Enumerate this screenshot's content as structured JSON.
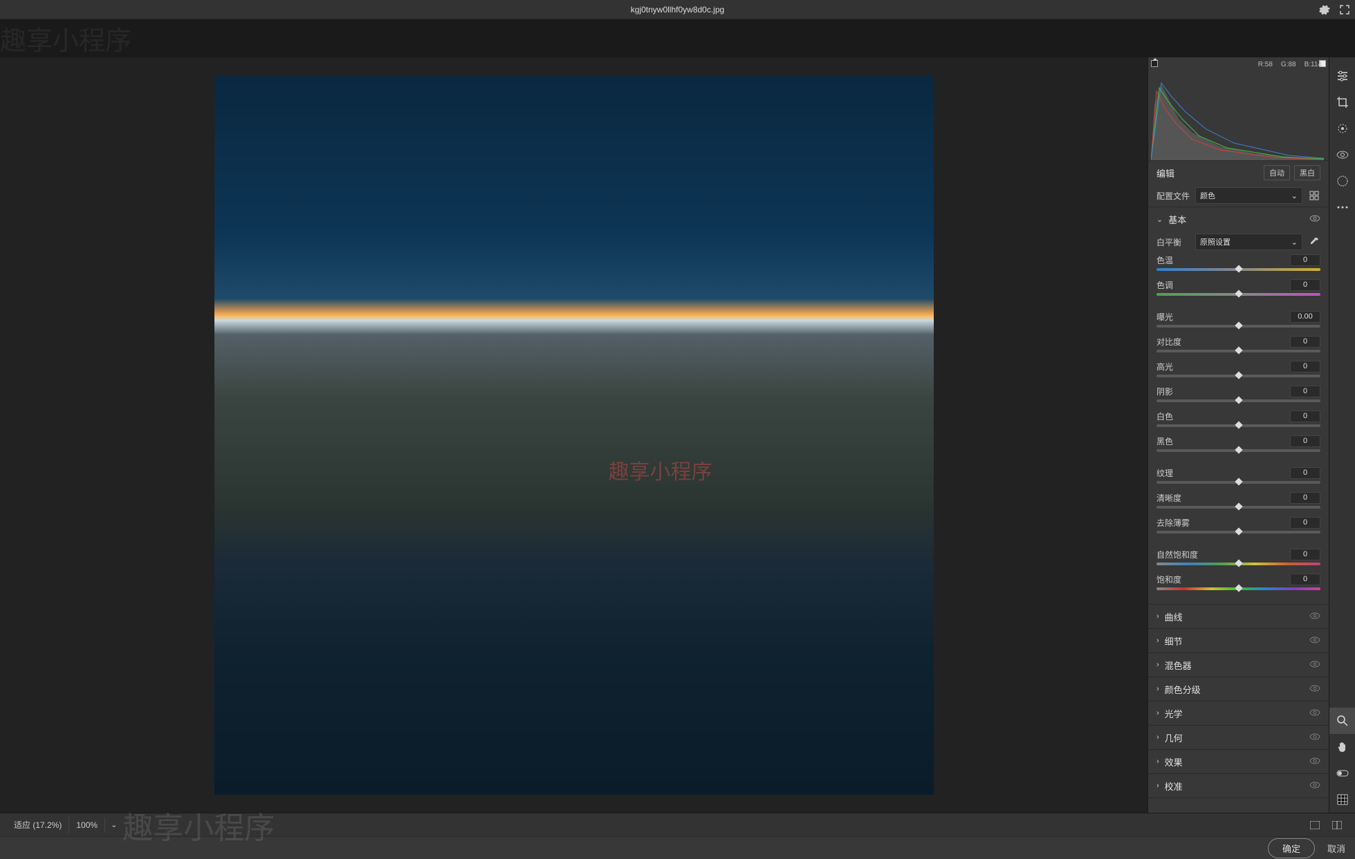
{
  "title": "kgj0tnyw0llhf0yw8d0c.jpg",
  "histogram": {
    "r": "R:58",
    "g": "G:88",
    "b": "B:114"
  },
  "edit": {
    "label": "编辑",
    "auto": "自动",
    "bw": "黑白"
  },
  "profile": {
    "label": "配置文件",
    "value": "颜色"
  },
  "basic": {
    "label": "基本",
    "wb_label": "白平衡",
    "wb_value": "原照设置",
    "sliders1": [
      {
        "label": "色温",
        "value": "0",
        "track": "temp",
        "pos": 50
      },
      {
        "label": "色调",
        "value": "0",
        "track": "tint",
        "pos": 50
      }
    ],
    "sliders2": [
      {
        "label": "曝光",
        "value": "0.00",
        "track": "gray",
        "pos": 50
      },
      {
        "label": "对比度",
        "value": "0",
        "track": "gray",
        "pos": 50
      },
      {
        "label": "高光",
        "value": "0",
        "track": "gray",
        "pos": 50
      },
      {
        "label": "阴影",
        "value": "0",
        "track": "gray",
        "pos": 50
      },
      {
        "label": "白色",
        "value": "0",
        "track": "gray",
        "pos": 50
      },
      {
        "label": "黑色",
        "value": "0",
        "track": "gray",
        "pos": 50
      }
    ],
    "sliders3": [
      {
        "label": "纹理",
        "value": "0",
        "track": "gray",
        "pos": 50
      },
      {
        "label": "清晰度",
        "value": "0",
        "track": "gray",
        "pos": 50
      },
      {
        "label": "去除薄雾",
        "value": "0",
        "track": "gray",
        "pos": 50
      }
    ],
    "sliders4": [
      {
        "label": "自然饱和度",
        "value": "0",
        "track": "vib",
        "pos": 50
      },
      {
        "label": "饱和度",
        "value": "0",
        "track": "sat",
        "pos": 50
      }
    ]
  },
  "sections": [
    {
      "label": "曲线"
    },
    {
      "label": "细节"
    },
    {
      "label": "混色器"
    },
    {
      "label": "颜色分级"
    },
    {
      "label": "光学"
    },
    {
      "label": "几何"
    },
    {
      "label": "效果"
    },
    {
      "label": "校准"
    }
  ],
  "zoom": {
    "fit": "适应 (17.2%)",
    "hundred": "100%"
  },
  "footer": {
    "ok": "确定",
    "cancel": "取消"
  },
  "watermark": "趣享小程序"
}
